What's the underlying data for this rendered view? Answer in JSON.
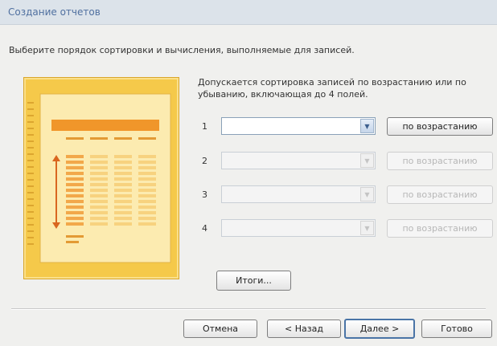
{
  "window": {
    "title": "Создание отчетов"
  },
  "instruction": "Выберите порядок сортировки и вычисления, выполняемые для записей.",
  "hint": "Допускается сортировка записей по возрастанию или по убыванию, включающая до 4 полей.",
  "sort_fields": [
    {
      "num": "1",
      "value": "",
      "order_label": "по возрастанию",
      "enabled": true
    },
    {
      "num": "2",
      "value": "",
      "order_label": "по возрастанию",
      "enabled": false
    },
    {
      "num": "3",
      "value": "",
      "order_label": "по возрастанию",
      "enabled": false
    },
    {
      "num": "4",
      "value": "",
      "order_label": "по возрастанию",
      "enabled": false
    }
  ],
  "summary_button": "Итоги...",
  "footer": {
    "cancel": "Отмена",
    "back": "< Назад",
    "next": "Далее >",
    "finish": "Готово"
  },
  "icons": {
    "dropdown": "chevron-down-icon",
    "illustration": "report-sort-illustration"
  },
  "colors": {
    "accent": "#4a74a6",
    "title_text": "#5070a0",
    "illustration": "#f5c94a"
  }
}
